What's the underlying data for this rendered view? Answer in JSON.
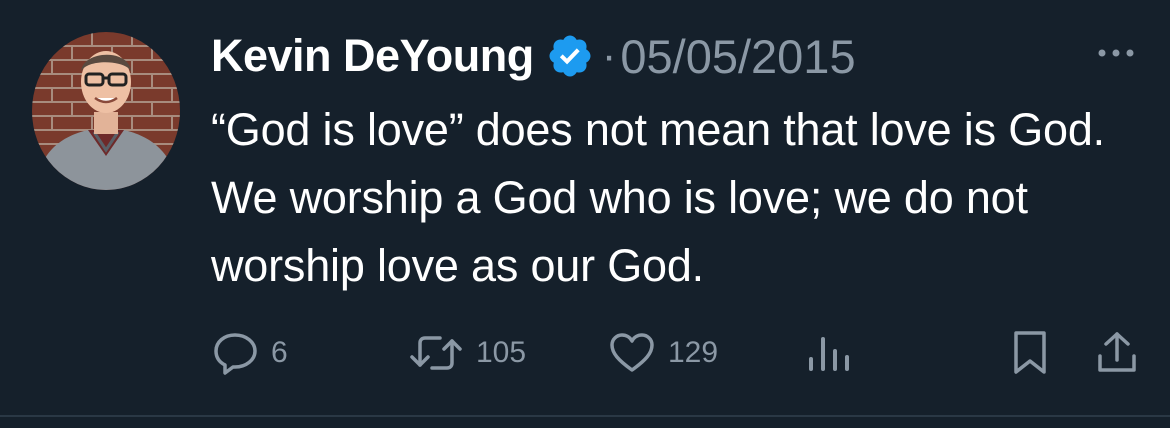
{
  "tweet": {
    "author_name": "Kevin DeYoung",
    "separator": "·",
    "date": "05/05/2015",
    "verified_icon": "verified-badge-icon",
    "text": "“God is love” does not mean that love is God. We worship a God who is love; we do not worship love as our God."
  },
  "actions": {
    "reply_count": "6",
    "retweet_count": "105",
    "like_count": "129"
  },
  "colors": {
    "background": "#15202b",
    "text": "#ffffff",
    "muted": "#8b98a5",
    "verified": "#1d9bf0"
  }
}
